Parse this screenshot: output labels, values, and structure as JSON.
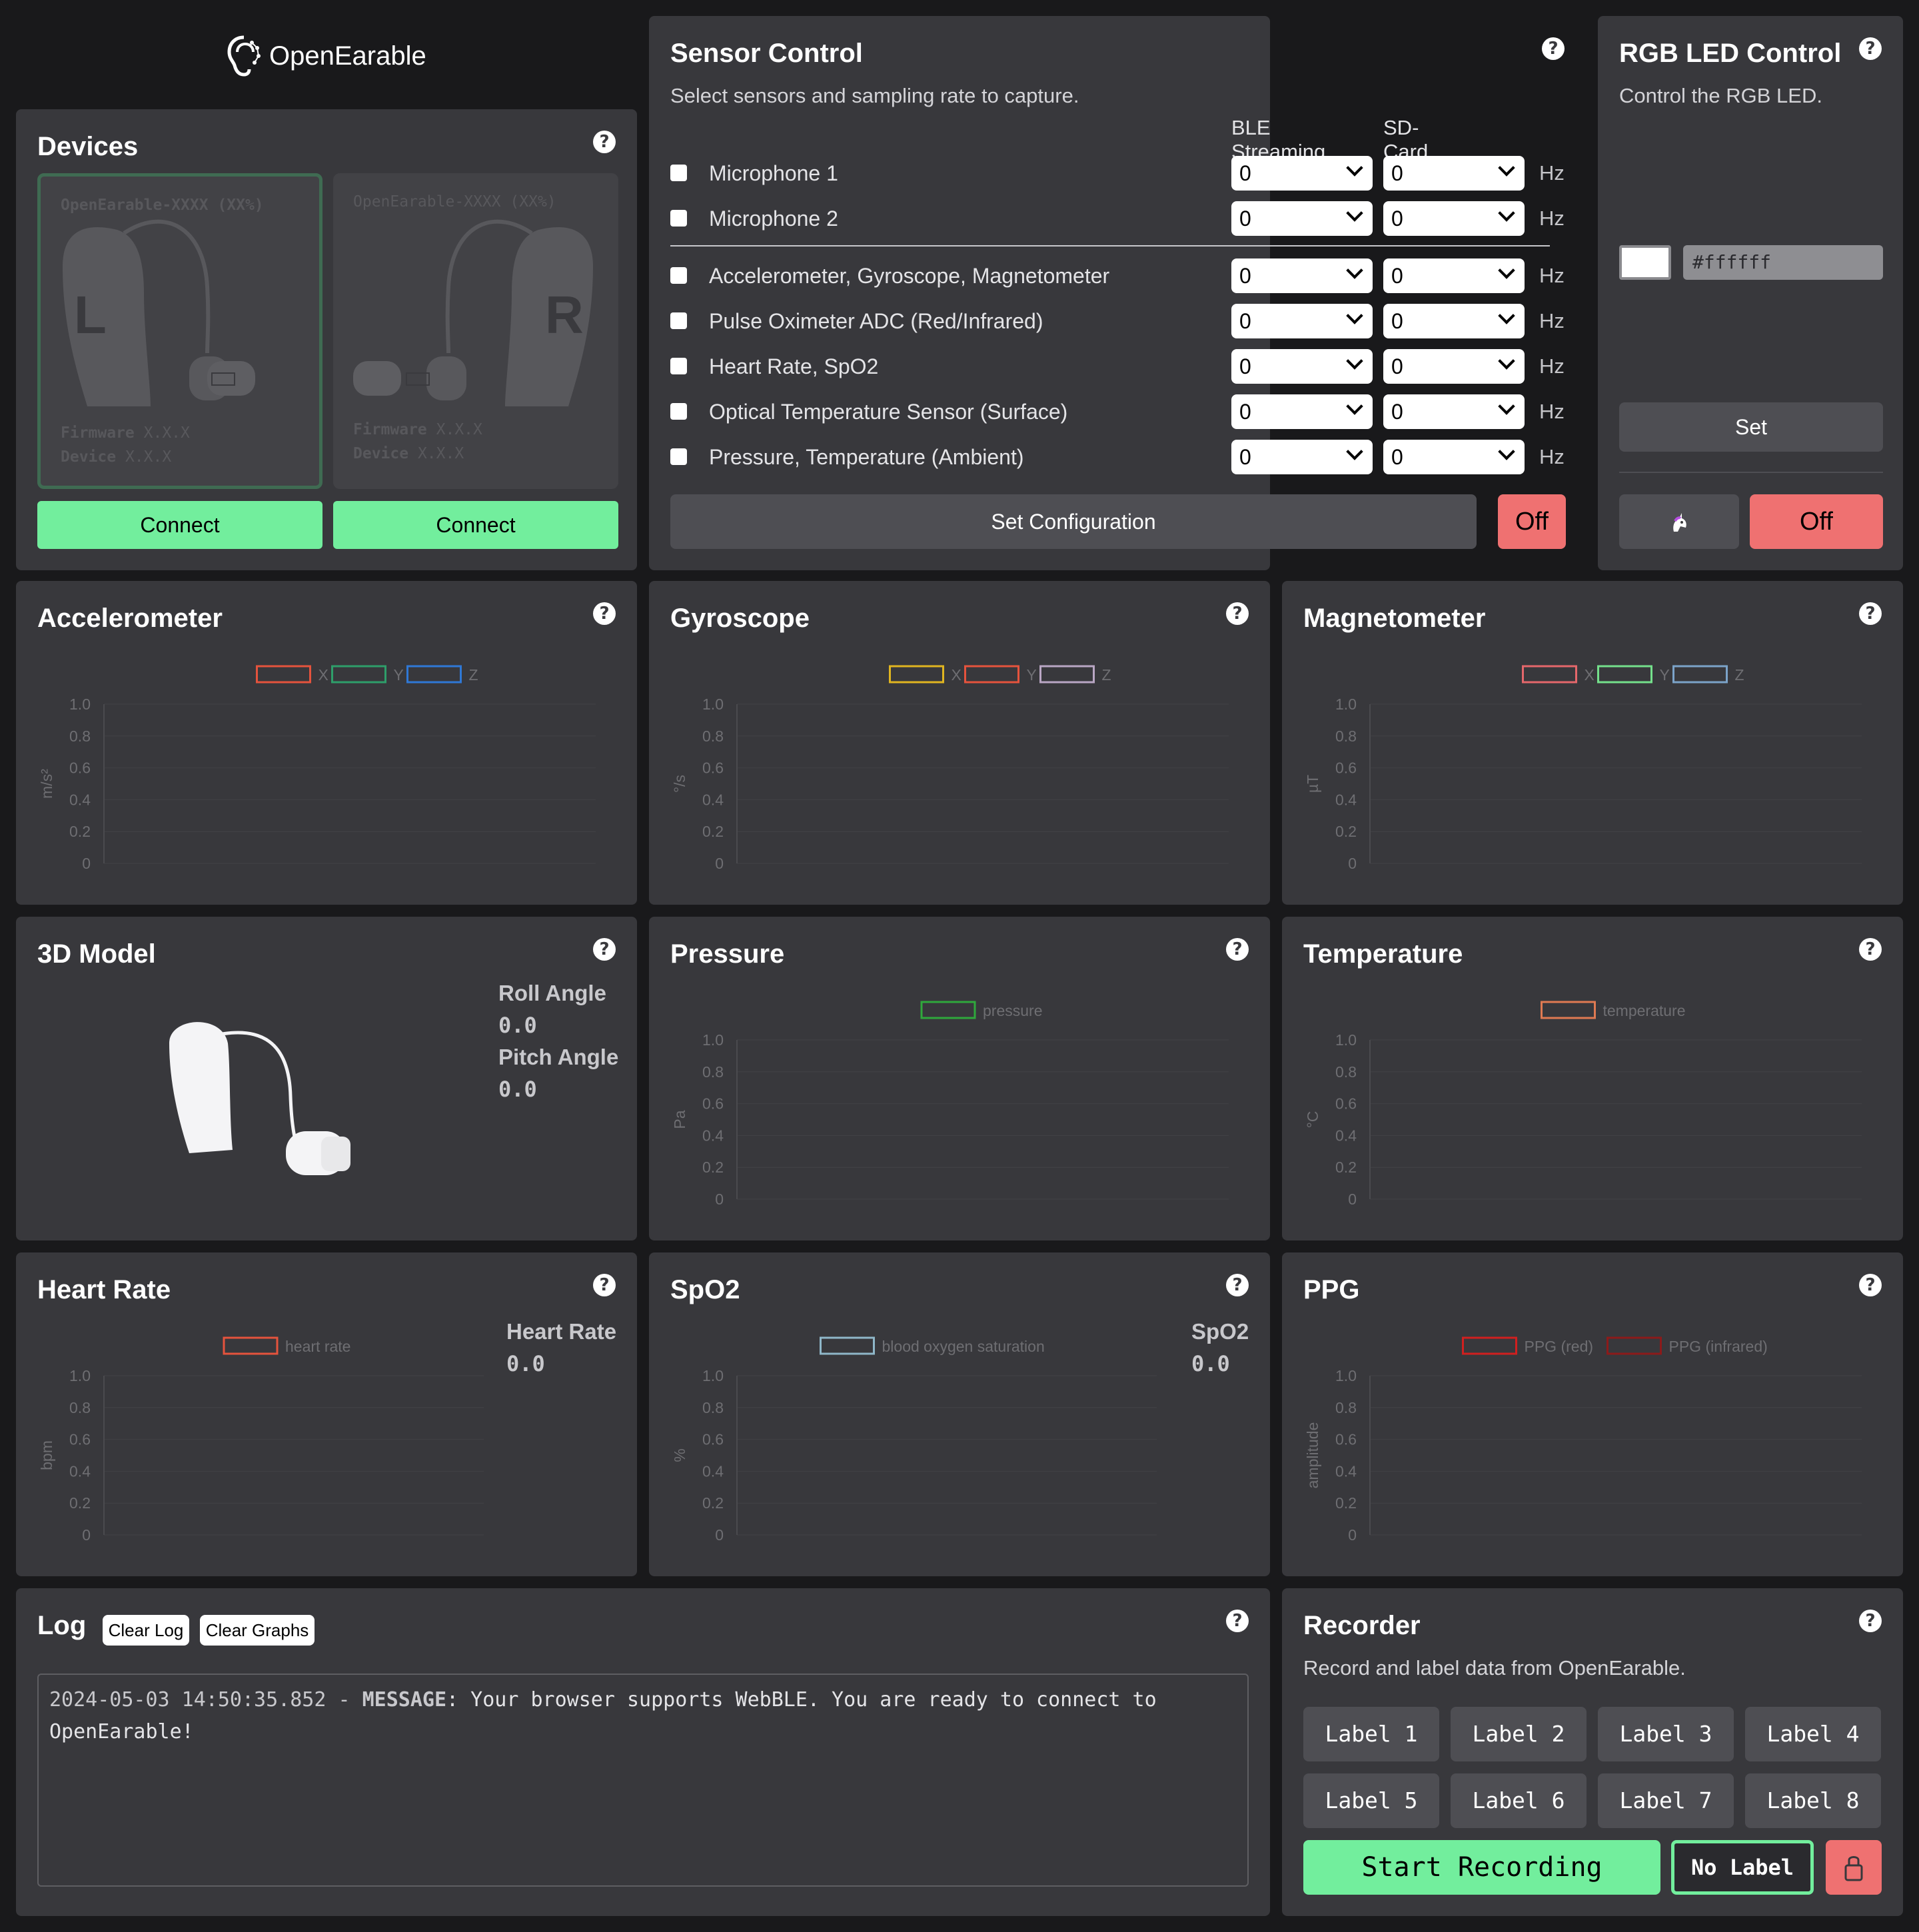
{
  "brand": {
    "name": "OpenEarable"
  },
  "devices": {
    "title": "Devices",
    "help": "?",
    "items": [
      {
        "name": "OpenEarable-XXXX (XX%)",
        "side": "L",
        "firmware_label": "Firmware",
        "firmware": "X.X.X",
        "device_label": "Device",
        "device": "X.X.X",
        "connect": "Connect"
      },
      {
        "name": "OpenEarable-XXXX (XX%)",
        "side": "R",
        "firmware_label": "Firmware",
        "firmware": "X.X.X",
        "device_label": "Device",
        "device": "X.X.X",
        "connect": "Connect"
      }
    ]
  },
  "sensor_control": {
    "title": "Sensor Control",
    "subtitle": "Select sensors and sampling rate to capture.",
    "help": "?",
    "col_ble": "BLE Streaming",
    "col_sd": "SD-Card",
    "unit": "Hz",
    "rows": [
      {
        "label": "Microphone 1",
        "ble": "0",
        "sd": "0"
      },
      {
        "label": "Microphone 2",
        "ble": "0",
        "sd": "0"
      },
      {
        "label": "Accelerometer, Gyroscope, Magnetometer",
        "ble": "0",
        "sd": "0"
      },
      {
        "label": "Pulse Oximeter ADC (Red/Infrared)",
        "ble": "0",
        "sd": "0"
      },
      {
        "label": "Heart Rate, SpO2",
        "ble": "0",
        "sd": "0"
      },
      {
        "label": "Optical Temperature Sensor (Surface)",
        "ble": "0",
        "sd": "0"
      },
      {
        "label": "Pressure, Temperature (Ambient)",
        "ble": "0",
        "sd": "0"
      }
    ],
    "set_config": "Set Configuration",
    "off": "Off"
  },
  "rgb": {
    "title": "RGB LED Control",
    "subtitle": "Control the RGB LED.",
    "help": "?",
    "color_value": "#ffffff",
    "set": "Set",
    "rainbow_icon": "unicorn-icon",
    "off": "Off"
  },
  "cards": {
    "accelerometer": "Accelerometer",
    "gyroscope": "Gyroscope",
    "magnetometer": "Magnetometer",
    "model": "3D Model",
    "pressure": "Pressure",
    "temperature": "Temperature",
    "heart_rate": "Heart Rate",
    "spo2": "SpO2",
    "ppg": "PPG",
    "help": "?"
  },
  "model": {
    "roll_label": "Roll Angle",
    "roll": "0.0",
    "pitch_label": "Pitch Angle",
    "pitch": "0.0"
  },
  "readouts": {
    "heart_rate_label": "Heart Rate",
    "heart_rate": "0.0",
    "spo2_label": "SpO2",
    "spo2": "0.0"
  },
  "log": {
    "title": "Log",
    "clear_log": "Clear Log",
    "clear_graphs": "Clear Graphs",
    "help": "?",
    "entry_time": "2024-05-03 14:50:35.852 - ",
    "entry_type": "MESSAGE",
    "entry_text": ": Your browser supports WebBLE. You are ready to connect to OpenEarable!"
  },
  "recorder": {
    "title": "Recorder",
    "subtitle": "Record and label data from OpenEarable.",
    "help": "?",
    "labels": [
      "Label 1",
      "Label 2",
      "Label 3",
      "Label 4",
      "Label 5",
      "Label 6",
      "Label 7",
      "Label 8"
    ],
    "start": "Start Recording",
    "no_label": "No Label",
    "lock_icon": "lock-icon"
  },
  "chart_data": [
    {
      "id": "acc",
      "type": "line",
      "ylabel": "m/s²",
      "yticks": [
        "1.0",
        "0.8",
        "0.6",
        "0.4",
        "0.2",
        "0"
      ],
      "ylim": [
        0,
        1
      ],
      "legend": [
        {
          "name": "X",
          "color": "#e5533d"
        },
        {
          "name": "Y",
          "color": "#2e9e6a"
        },
        {
          "name": "Z",
          "color": "#2f78d6"
        }
      ],
      "series": []
    },
    {
      "id": "gyro",
      "type": "line",
      "ylabel": "°/s",
      "yticks": [
        "1.0",
        "0.8",
        "0.6",
        "0.4",
        "0.2",
        "0"
      ],
      "ylim": [
        0,
        1
      ],
      "legend": [
        {
          "name": "X",
          "color": "#e0b520"
        },
        {
          "name": "Y",
          "color": "#e5533d"
        },
        {
          "name": "Z",
          "color": "#b9a6c4"
        }
      ],
      "series": []
    },
    {
      "id": "mag",
      "type": "line",
      "ylabel": "µT",
      "yticks": [
        "1.0",
        "0.8",
        "0.6",
        "0.4",
        "0.2",
        "0"
      ],
      "ylim": [
        0,
        1
      ],
      "legend": [
        {
          "name": "X",
          "color": "#e5676b"
        },
        {
          "name": "Y",
          "color": "#74e08b"
        },
        {
          "name": "Z",
          "color": "#7ba3c9"
        }
      ],
      "series": []
    },
    {
      "id": "press",
      "type": "line",
      "ylabel": "Pa",
      "yticks": [
        "1.0",
        "0.8",
        "0.6",
        "0.4",
        "0.2",
        "0"
      ],
      "ylim": [
        0,
        1
      ],
      "legend": [
        {
          "name": "pressure",
          "color": "#2fa83c"
        }
      ],
      "series": []
    },
    {
      "id": "temp",
      "type": "line",
      "ylabel": "°C",
      "yticks": [
        "1.0",
        "0.8",
        "0.6",
        "0.4",
        "0.2",
        "0"
      ],
      "ylim": [
        0,
        1
      ],
      "legend": [
        {
          "name": "temperature",
          "color": "#e07a52"
        }
      ],
      "series": []
    },
    {
      "id": "hr",
      "type": "line",
      "ylabel": "bpm",
      "yticks": [
        "1.0",
        "0.8",
        "0.6",
        "0.4",
        "0.2",
        "0"
      ],
      "ylim": [
        0,
        1
      ],
      "legend": [
        {
          "name": "heart rate",
          "color": "#e5533d"
        }
      ],
      "series": []
    },
    {
      "id": "spo2",
      "type": "line",
      "ylabel": "%",
      "yticks": [
        "1.0",
        "0.8",
        "0.6",
        "0.4",
        "0.2",
        "0"
      ],
      "ylim": [
        0,
        1
      ],
      "legend": [
        {
          "name": "blood oxygen saturation",
          "color": "#8fb7c9"
        }
      ],
      "series": []
    },
    {
      "id": "ppg",
      "type": "line",
      "ylabel": "amplitude",
      "yticks": [
        "1.0",
        "0.8",
        "0.6",
        "0.4",
        "0.2",
        "0"
      ],
      "ylim": [
        0,
        1
      ],
      "legend": [
        {
          "name": "PPG (red)",
          "color": "#d11f1f"
        },
        {
          "name": "PPG (infrared)",
          "color": "#8c1a1a"
        }
      ],
      "series": []
    }
  ]
}
